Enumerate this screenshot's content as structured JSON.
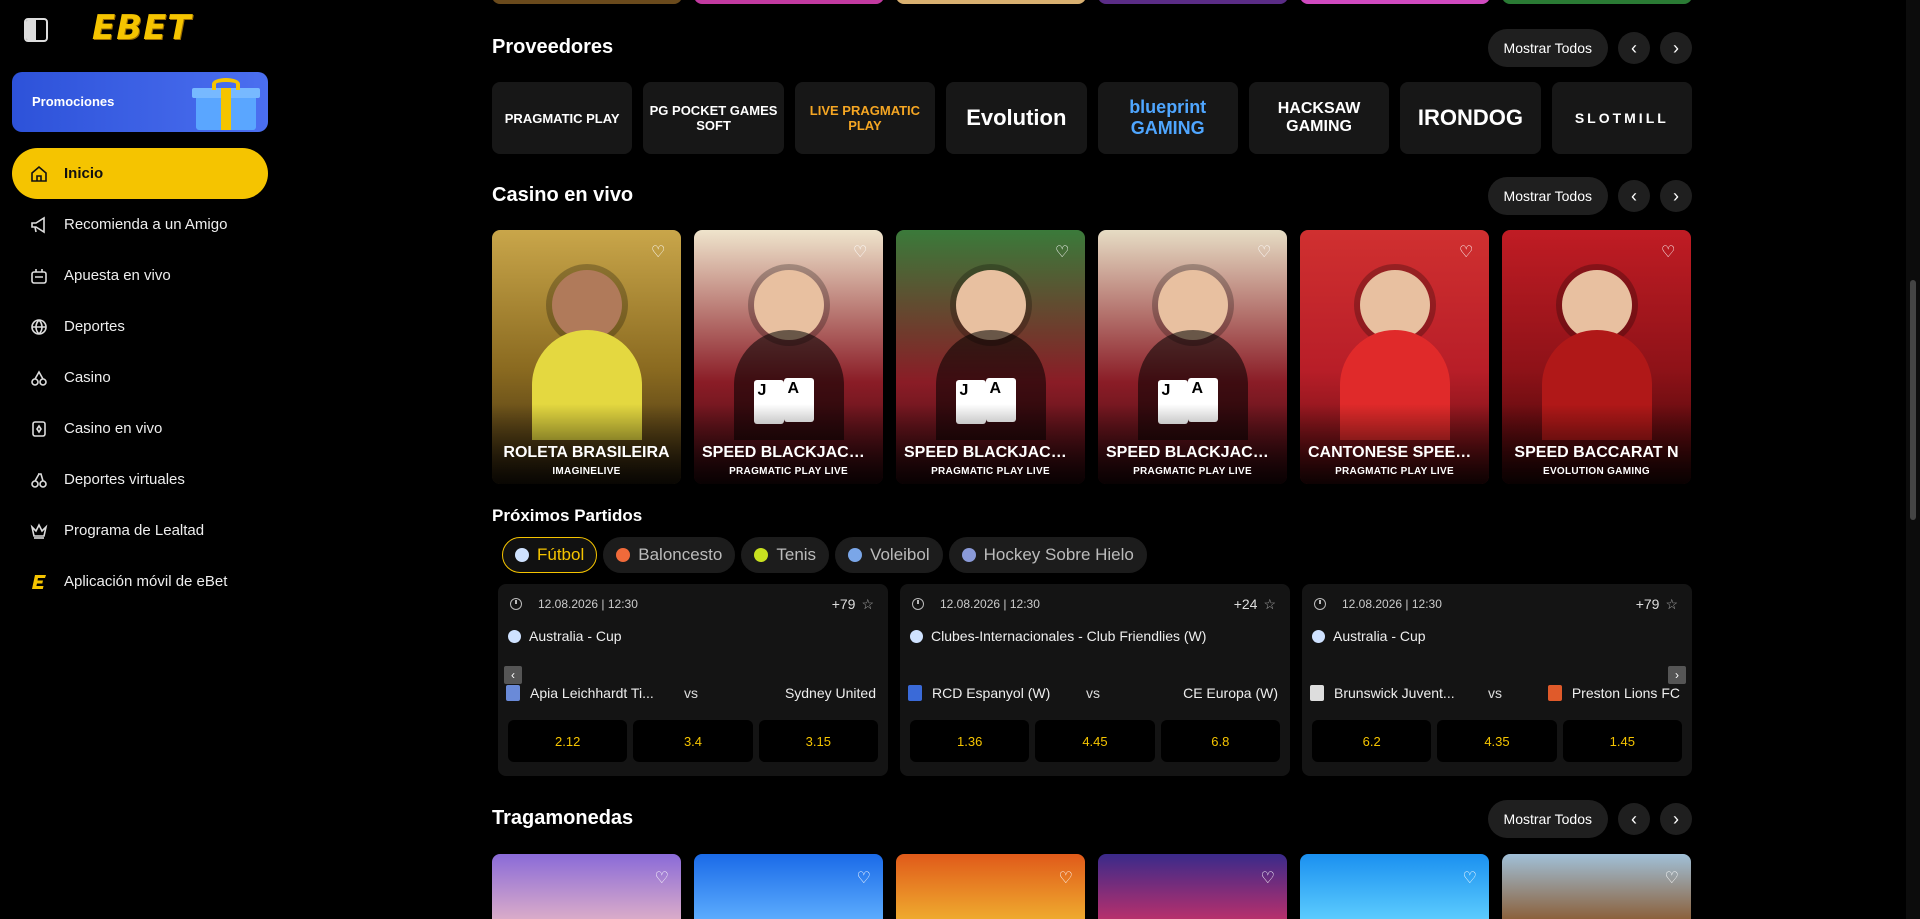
{
  "brand": {
    "logo_text": "EBET",
    "accent": "#f5c400"
  },
  "sidebar": {
    "promo_label": "Promociones",
    "items": [
      {
        "label": "Inicio",
        "icon": "home-icon",
        "active": true
      },
      {
        "label": "Recomienda a un Amigo",
        "icon": "megaphone-icon"
      },
      {
        "label": "Apuesta en vivo",
        "icon": "live-bet-icon"
      },
      {
        "label": "Deportes",
        "icon": "ball-icon"
      },
      {
        "label": "Casino",
        "icon": "casino-icon"
      },
      {
        "label": "Casino en vivo",
        "icon": "live-casino-icon"
      },
      {
        "label": "Deportes virtuales",
        "icon": "virtual-sports-icon"
      },
      {
        "label": "Programa de Lealtad",
        "icon": "crown-icon"
      },
      {
        "label": "Aplicación móvil de eBet",
        "icon": "ebet-app-icon"
      }
    ]
  },
  "common": {
    "show_all": "Mostrar Todos"
  },
  "providers": {
    "title": "Proveedores",
    "items": [
      "PRAGMATIC PLAY",
      "PG POCKET GAMES SOFT",
      "LIVE PRAGMATIC PLAY",
      "Evolution",
      "blueprint GAMING",
      "HACKSAW GAMING",
      "IRONDOG",
      "SLOTMILL"
    ]
  },
  "live_casino": {
    "title": "Casino en vivo",
    "items": [
      {
        "name": "ROLETA BRASILEIRA",
        "provider": "IMAGINELIVE"
      },
      {
        "name": "SPEED BLACKJACK ...",
        "provider": "PRAGMATIC PLAY LIVE"
      },
      {
        "name": "SPEED BLACKJACK ...",
        "provider": "PRAGMATIC PLAY LIVE"
      },
      {
        "name": "SPEED BLACKJACK ...",
        "provider": "PRAGMATIC PLAY LIVE"
      },
      {
        "name": "CANTONESE SPEED ...",
        "provider": "PRAGMATIC PLAY LIVE"
      },
      {
        "name": "SPEED BACCARAT N",
        "provider": "EVOLUTION GAMING"
      }
    ]
  },
  "matches": {
    "title": "Próximos Partidos",
    "sports": [
      {
        "label": "Fútbol",
        "active": true
      },
      {
        "label": "Baloncesto"
      },
      {
        "label": "Tenis"
      },
      {
        "label": "Voleibol"
      },
      {
        "label": "Hockey Sobre Hielo"
      }
    ],
    "vs": "vs",
    "items": [
      {
        "datetime": "12.08.2026 | 12:30",
        "markets": "+79",
        "league": "Australia - Cup",
        "home": "Apia Leichhardt Ti...",
        "away": "Sydney United",
        "odds": [
          "2.12",
          "3.4",
          "3.15"
        ]
      },
      {
        "datetime": "12.08.2026 | 12:30",
        "markets": "+24",
        "league": "Clubes-Internacionales - Club Friendlies (W)",
        "home": "RCD Espanyol (W)",
        "away": "CE Europa (W)",
        "odds": [
          "1.36",
          "4.45",
          "6.8"
        ]
      },
      {
        "datetime": "12.08.2026 | 12:30",
        "markets": "+79",
        "league": "Australia - Cup",
        "home": "Brunswick Juvent...",
        "away": "Preston Lions FC",
        "odds": [
          "6.2",
          "4.35",
          "1.45"
        ]
      }
    ]
  },
  "slots": {
    "title": "Tragamonedas"
  }
}
